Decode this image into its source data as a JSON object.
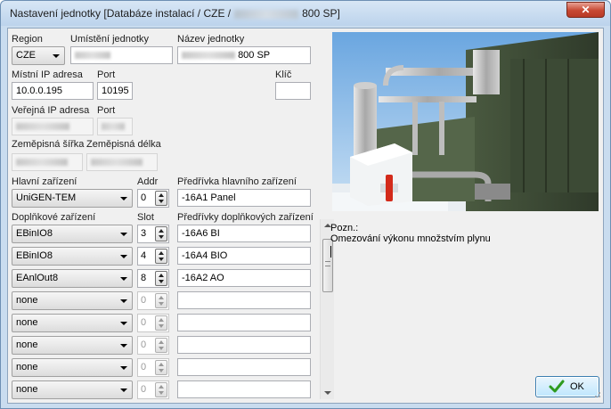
{
  "window": {
    "title_prefix": "Nastavení jednotky [Databáze instalací / CZE /",
    "title_suffix": "800 SP]",
    "close_glyph": "✕"
  },
  "labels": {
    "region": "Region",
    "location": "Umístění jednotky",
    "unit_name": "Název jednotky",
    "local_ip": "Místní IP adresa",
    "port1": "Port",
    "key": "Klíč",
    "public_ip": "Veřejná IP adresa",
    "port2": "Port",
    "latitude": "Zeměpisná šířka",
    "longitude": "Zeměpisná délka",
    "main_device": "Hlavní zařízení",
    "addr": "Addr",
    "main_prefix": "Předřívka hlavního zařízení",
    "extra_device": "Doplňkové zařízení",
    "slot": "Slot",
    "extra_prefixes": "Předřívky doplňkových zařízení",
    "notes": "Pozn.:"
  },
  "fields": {
    "region": "CZE",
    "unit_name_suffix": "800 SP",
    "local_ip": "10.0.0.195",
    "port1": "10195",
    "key": "",
    "main_device": "UniGEN-TEM",
    "addr": "0",
    "main_prefix": "-16A1 Panel"
  },
  "extra_devices": [
    {
      "device": "EBinIO8",
      "slot": "3",
      "prefix": "-16A6 BI",
      "enabled": true
    },
    {
      "device": "EBinIO8",
      "slot": "4",
      "prefix": "-16A4 BIO",
      "enabled": true
    },
    {
      "device": "EAnlOut8",
      "slot": "8",
      "prefix": "-16A2 AO",
      "enabled": true
    },
    {
      "device": "none",
      "slot": "0",
      "prefix": "",
      "enabled": false
    },
    {
      "device": "none",
      "slot": "0",
      "prefix": "",
      "enabled": false
    },
    {
      "device": "none",
      "slot": "0",
      "prefix": "",
      "enabled": false
    },
    {
      "device": "none",
      "slot": "0",
      "prefix": "",
      "enabled": false
    },
    {
      "device": "none",
      "slot": "0",
      "prefix": "",
      "enabled": false
    }
  ],
  "notes_text": "Omezování výkonu množstvím plynu",
  "ok_button": "OK",
  "colors": {
    "accent_button": "#bee6fd",
    "close_button": "#c74832",
    "check_icon": "#2e9b1f"
  }
}
